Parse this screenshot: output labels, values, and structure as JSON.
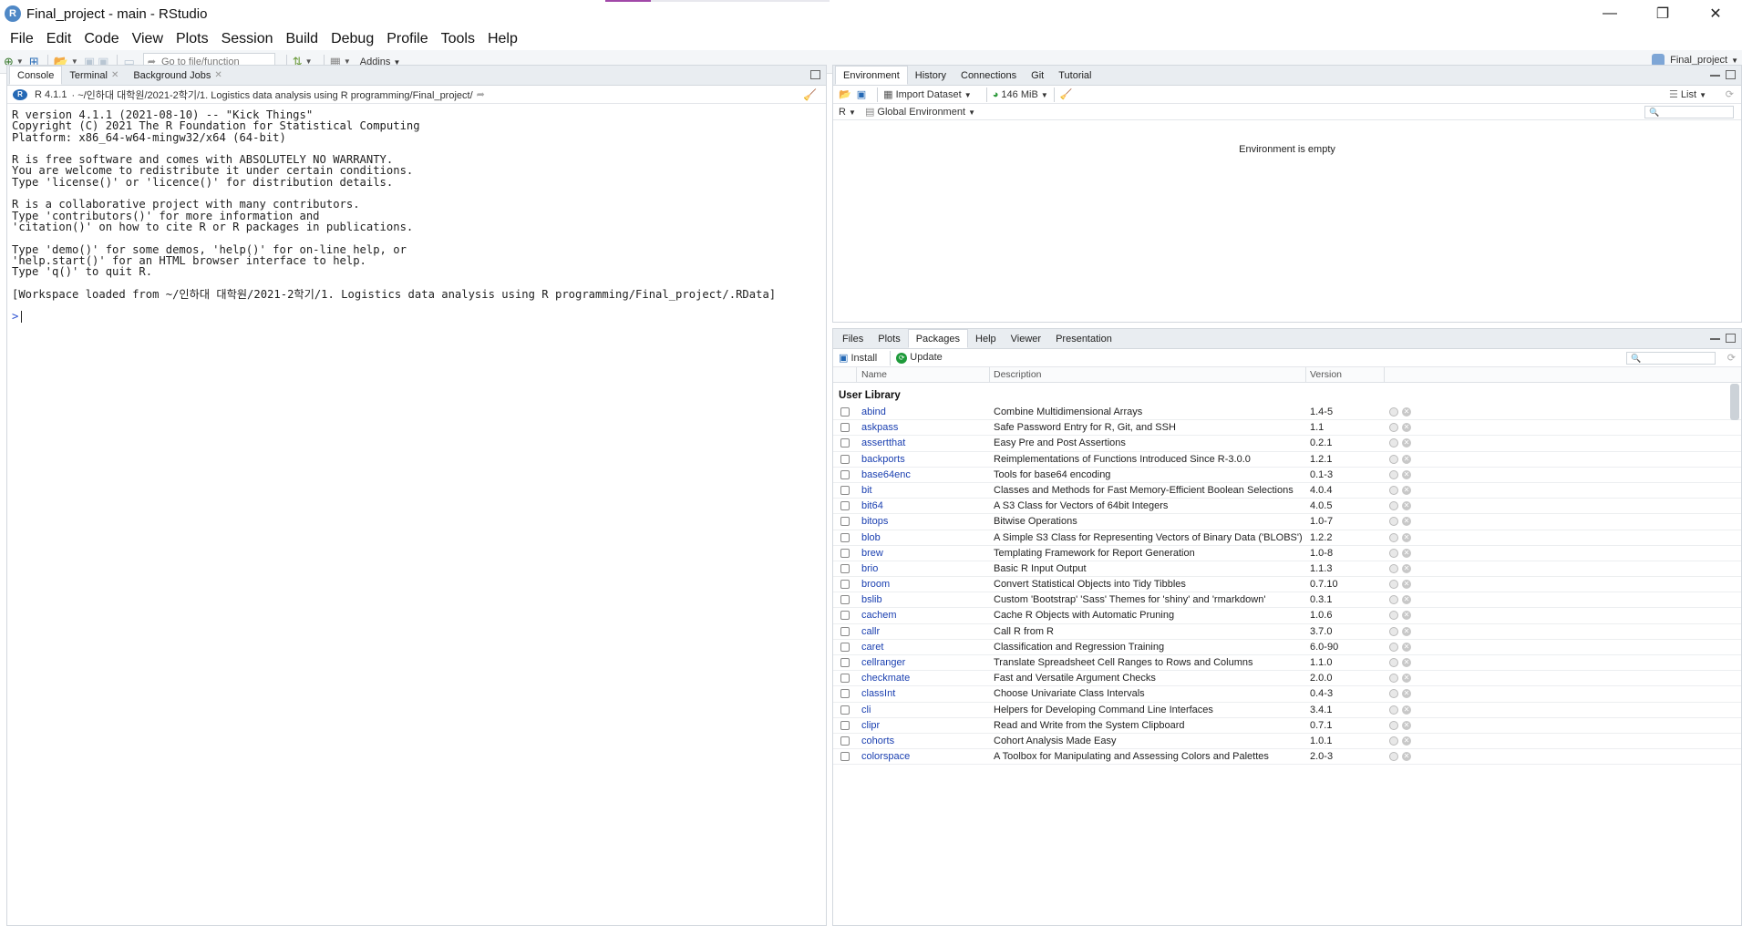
{
  "window": {
    "app_badge": "R",
    "title": "Final_project - main - RStudio",
    "controls": {
      "minimize": "—",
      "maximize": "❐",
      "close": "✕"
    }
  },
  "menu": [
    "File",
    "Edit",
    "Code",
    "View",
    "Plots",
    "Session",
    "Build",
    "Debug",
    "Profile",
    "Tools",
    "Help"
  ],
  "toolbar": {
    "goto_placeholder": "Go to file/function",
    "addins": "Addins",
    "project": "Final_project"
  },
  "console_pane": {
    "tabs": [
      {
        "label": "Console",
        "closable": false
      },
      {
        "label": "Terminal",
        "closable": true
      },
      {
        "label": "Background Jobs",
        "closable": true
      }
    ],
    "r_version_label": "R 4.1.1",
    "path": "· ~/인하대 대학원/2021-2학기/1. Logistics data analysis using R programming/Final_project/",
    "output": [
      "R version 4.1.1 (2021-08-10) -- \"Kick Things\"",
      "Copyright (C) 2021 The R Foundation for Statistical Computing",
      "Platform: x86_64-w64-mingw32/x64 (64-bit)",
      "",
      "R is free software and comes with ABSOLUTELY NO WARRANTY.",
      "You are welcome to redistribute it under certain conditions.",
      "Type 'license()' or 'licence()' for distribution details.",
      "",
      "R is a collaborative project with many contributors.",
      "Type 'contributors()' for more information and",
      "'citation()' on how to cite R or R packages in publications.",
      "",
      "Type 'demo()' for some demos, 'help()' for on-line help, or",
      "'help.start()' for an HTML browser interface to help.",
      "Type 'q()' to quit R.",
      "",
      "[Workspace loaded from ~/인하대 대학원/2021-2학기/1. Logistics data analysis using R programming/Final_project/.RData]",
      ""
    ],
    "prompt": ">"
  },
  "env_pane": {
    "tabs": [
      "Environment",
      "History",
      "Connections",
      "Git",
      "Tutorial"
    ],
    "import_dataset": "Import Dataset",
    "memory": "146 MiB",
    "view_mode": "List",
    "language": "R",
    "scope": "Global Environment",
    "empty_message": "Environment is empty"
  },
  "packages_pane": {
    "tabs": [
      "Files",
      "Plots",
      "Packages",
      "Help",
      "Viewer",
      "Presentation"
    ],
    "active_tab": "Packages",
    "install": "Install",
    "update": "Update",
    "columns": {
      "name": "Name",
      "description": "Description",
      "version": "Version"
    },
    "section": "User Library",
    "rows": [
      {
        "name": "abind",
        "description": "Combine Multidimensional Arrays",
        "version": "1.4-5"
      },
      {
        "name": "askpass",
        "description": "Safe Password Entry for R, Git, and SSH",
        "version": "1.1"
      },
      {
        "name": "assertthat",
        "description": "Easy Pre and Post Assertions",
        "version": "0.2.1"
      },
      {
        "name": "backports",
        "description": "Reimplementations of Functions Introduced Since R-3.0.0",
        "version": "1.2.1"
      },
      {
        "name": "base64enc",
        "description": "Tools for base64 encoding",
        "version": "0.1-3"
      },
      {
        "name": "bit",
        "description": "Classes and Methods for Fast Memory-Efficient Boolean Selections",
        "version": "4.0.4"
      },
      {
        "name": "bit64",
        "description": "A S3 Class for Vectors of 64bit Integers",
        "version": "4.0.5"
      },
      {
        "name": "bitops",
        "description": "Bitwise Operations",
        "version": "1.0-7"
      },
      {
        "name": "blob",
        "description": "A Simple S3 Class for Representing Vectors of Binary Data ('BLOBS')",
        "version": "1.2.2"
      },
      {
        "name": "brew",
        "description": "Templating Framework for Report Generation",
        "version": "1.0-8"
      },
      {
        "name": "brio",
        "description": "Basic R Input Output",
        "version": "1.1.3"
      },
      {
        "name": "broom",
        "description": "Convert Statistical Objects into Tidy Tibbles",
        "version": "0.7.10"
      },
      {
        "name": "bslib",
        "description": "Custom 'Bootstrap' 'Sass' Themes for 'shiny' and 'rmarkdown'",
        "version": "0.3.1"
      },
      {
        "name": "cachem",
        "description": "Cache R Objects with Automatic Pruning",
        "version": "1.0.6"
      },
      {
        "name": "callr",
        "description": "Call R from R",
        "version": "3.7.0"
      },
      {
        "name": "caret",
        "description": "Classification and Regression Training",
        "version": "6.0-90"
      },
      {
        "name": "cellranger",
        "description": "Translate Spreadsheet Cell Ranges to Rows and Columns",
        "version": "1.1.0"
      },
      {
        "name": "checkmate",
        "description": "Fast and Versatile Argument Checks",
        "version": "2.0.0"
      },
      {
        "name": "classInt",
        "description": "Choose Univariate Class Intervals",
        "version": "0.4-3"
      },
      {
        "name": "cli",
        "description": "Helpers for Developing Command Line Interfaces",
        "version": "3.4.1"
      },
      {
        "name": "clipr",
        "description": "Read and Write from the System Clipboard",
        "version": "0.7.1"
      },
      {
        "name": "cohorts",
        "description": "Cohort Analysis Made Easy",
        "version": "1.0.1"
      },
      {
        "name": "colorspace",
        "description": "A Toolbox for Manipulating and Assessing Colors and Palettes",
        "version": "2.0-3"
      }
    ]
  },
  "colors": {
    "link": "#1a3fb0",
    "r_blue": "#2569b5",
    "prompt": "#2b4fd1",
    "update_green": "#1e9a3a"
  }
}
